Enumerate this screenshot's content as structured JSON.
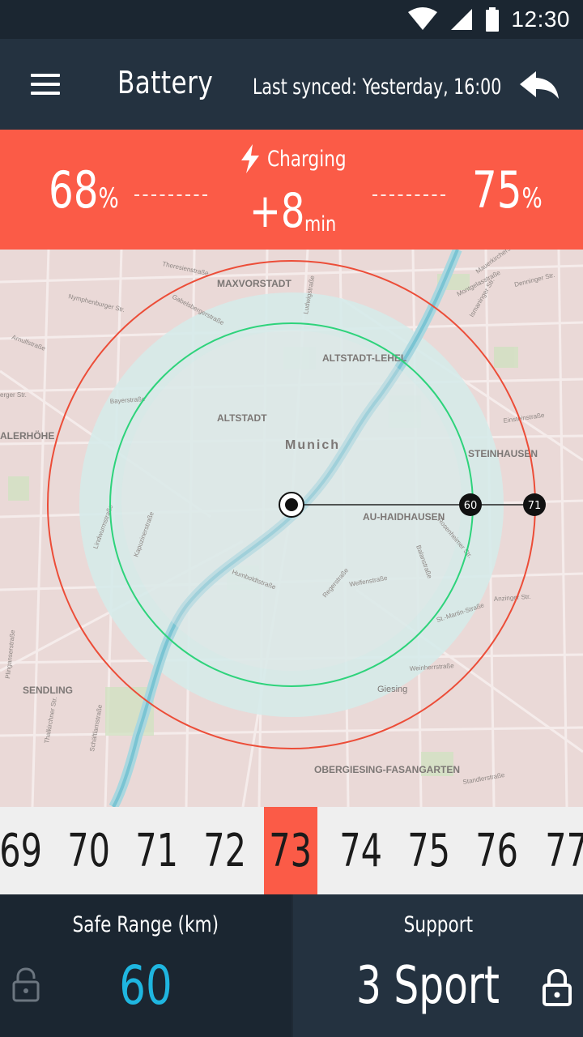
{
  "status_bar": {
    "time": "12:30",
    "icons": [
      "wifi-icon",
      "signal-icon",
      "battery-icon"
    ]
  },
  "app_bar": {
    "title": "Battery",
    "last_synced": "Last synced: Yesterday, 16:00",
    "icons": [
      "menu-icon",
      "back-icon"
    ]
  },
  "charge": {
    "current_value": "68",
    "target_value": "75",
    "percent_unit": "%",
    "status_label": "Charging",
    "time_delta_value": "+8",
    "time_delta_unit": "min",
    "icon": "lightning-icon"
  },
  "map": {
    "labels": {
      "maxvorstadt": "MAXVORSTADT",
      "altstadt_lehel": "ALTSTADT-LEHEL",
      "altstadt": "ALTSTADT",
      "munich": "Munich",
      "steinhausen": "STEINHAUSEN",
      "alerhohe": "ALERHÖHE",
      "au_haidhausen": "AU-HAIDHAUSEN",
      "sendling": "SENDLING",
      "giesing": "Giesing",
      "obergiesing": "OBERGIESING-FASANGARTEN"
    },
    "streets": {
      "theresienstr": "Theresienstraße",
      "nymphenburger": "Nymphenburger Str.",
      "arnulfstr": "Arnulfstraße",
      "bayerstr": "Bayerstraße",
      "erger_str": "erger Str.",
      "gabelsberger": "Gabelsbergerstraße",
      "ludwigstr": "Ludwigstraße",
      "mauerkircher": "Mauerkircherstraße",
      "montgelas": "Montgelasstraße",
      "denninger": "Denninger Str.",
      "ismaninger": "Ismaninger Str.",
      "einsteinstr": "Einsteinstraße",
      "anzinger": "Anzinger Str.",
      "st_martin": "St.-Martin-Straße",
      "weinherrstr": "Weinherrstraße",
      "standlerstr": "Standlerstraße",
      "kapuziner": "Kapuzinerstraße",
      "lindwurm": "Lindwurmstraße",
      "humboldt": "Humboldtstraße",
      "welfen": "Welfenstraße",
      "regerstr": "Regerstraße",
      "balanstr": "Balanstraße",
      "rosenheimer": "Rosenheimer Str.",
      "plinganser": "Plinganserstraße",
      "thalkirchner": "Thalkirchner Str.",
      "schaftlarn": "Schäftlarnstraße"
    },
    "range_markers": {
      "safe": "60",
      "max": "71"
    }
  },
  "range_selector": {
    "values": [
      "69",
      "70",
      "71",
      "72",
      "73",
      "74",
      "75",
      "76",
      "77"
    ],
    "selected": "73"
  },
  "safe_range": {
    "title": "Safe Range (km)",
    "value": "60",
    "icon": "lock-icon"
  },
  "support": {
    "title": "Support",
    "value": "3 Sport",
    "icon": "lock-icon"
  },
  "colors": {
    "accent": "#fb5b47",
    "safe_blue": "#1fb6e0",
    "range_green": "#2ed37b",
    "range_red": "#ec4d38",
    "header_dark": "#243240",
    "status_dark": "#1b2631"
  }
}
